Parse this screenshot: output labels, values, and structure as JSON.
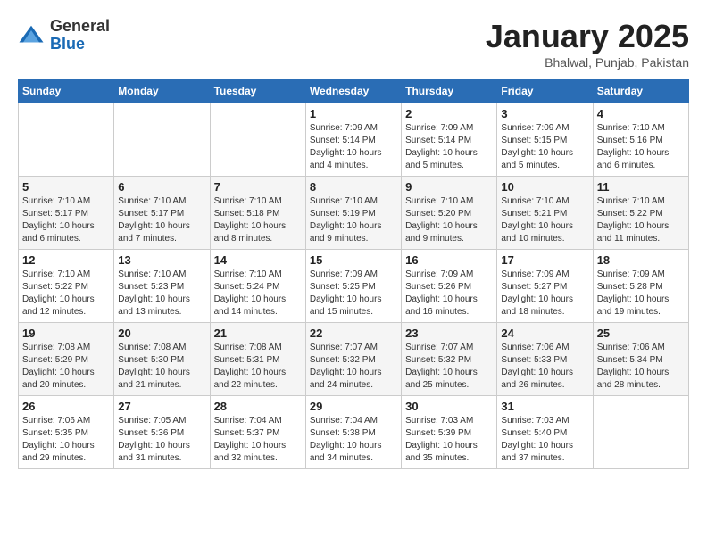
{
  "header": {
    "logo_general": "General",
    "logo_blue": "Blue",
    "month_title": "January 2025",
    "location": "Bhalwal, Punjab, Pakistan"
  },
  "weekdays": [
    "Sunday",
    "Monday",
    "Tuesday",
    "Wednesday",
    "Thursday",
    "Friday",
    "Saturday"
  ],
  "weeks": [
    [
      {
        "day": "",
        "info": ""
      },
      {
        "day": "",
        "info": ""
      },
      {
        "day": "",
        "info": ""
      },
      {
        "day": "1",
        "info": "Sunrise: 7:09 AM\nSunset: 5:14 PM\nDaylight: 10 hours\nand 4 minutes."
      },
      {
        "day": "2",
        "info": "Sunrise: 7:09 AM\nSunset: 5:14 PM\nDaylight: 10 hours\nand 5 minutes."
      },
      {
        "day": "3",
        "info": "Sunrise: 7:09 AM\nSunset: 5:15 PM\nDaylight: 10 hours\nand 5 minutes."
      },
      {
        "day": "4",
        "info": "Sunrise: 7:10 AM\nSunset: 5:16 PM\nDaylight: 10 hours\nand 6 minutes."
      }
    ],
    [
      {
        "day": "5",
        "info": "Sunrise: 7:10 AM\nSunset: 5:17 PM\nDaylight: 10 hours\nand 6 minutes."
      },
      {
        "day": "6",
        "info": "Sunrise: 7:10 AM\nSunset: 5:17 PM\nDaylight: 10 hours\nand 7 minutes."
      },
      {
        "day": "7",
        "info": "Sunrise: 7:10 AM\nSunset: 5:18 PM\nDaylight: 10 hours\nand 8 minutes."
      },
      {
        "day": "8",
        "info": "Sunrise: 7:10 AM\nSunset: 5:19 PM\nDaylight: 10 hours\nand 9 minutes."
      },
      {
        "day": "9",
        "info": "Sunrise: 7:10 AM\nSunset: 5:20 PM\nDaylight: 10 hours\nand 9 minutes."
      },
      {
        "day": "10",
        "info": "Sunrise: 7:10 AM\nSunset: 5:21 PM\nDaylight: 10 hours\nand 10 minutes."
      },
      {
        "day": "11",
        "info": "Sunrise: 7:10 AM\nSunset: 5:22 PM\nDaylight: 10 hours\nand 11 minutes."
      }
    ],
    [
      {
        "day": "12",
        "info": "Sunrise: 7:10 AM\nSunset: 5:22 PM\nDaylight: 10 hours\nand 12 minutes."
      },
      {
        "day": "13",
        "info": "Sunrise: 7:10 AM\nSunset: 5:23 PM\nDaylight: 10 hours\nand 13 minutes."
      },
      {
        "day": "14",
        "info": "Sunrise: 7:10 AM\nSunset: 5:24 PM\nDaylight: 10 hours\nand 14 minutes."
      },
      {
        "day": "15",
        "info": "Sunrise: 7:09 AM\nSunset: 5:25 PM\nDaylight: 10 hours\nand 15 minutes."
      },
      {
        "day": "16",
        "info": "Sunrise: 7:09 AM\nSunset: 5:26 PM\nDaylight: 10 hours\nand 16 minutes."
      },
      {
        "day": "17",
        "info": "Sunrise: 7:09 AM\nSunset: 5:27 PM\nDaylight: 10 hours\nand 18 minutes."
      },
      {
        "day": "18",
        "info": "Sunrise: 7:09 AM\nSunset: 5:28 PM\nDaylight: 10 hours\nand 19 minutes."
      }
    ],
    [
      {
        "day": "19",
        "info": "Sunrise: 7:08 AM\nSunset: 5:29 PM\nDaylight: 10 hours\nand 20 minutes."
      },
      {
        "day": "20",
        "info": "Sunrise: 7:08 AM\nSunset: 5:30 PM\nDaylight: 10 hours\nand 21 minutes."
      },
      {
        "day": "21",
        "info": "Sunrise: 7:08 AM\nSunset: 5:31 PM\nDaylight: 10 hours\nand 22 minutes."
      },
      {
        "day": "22",
        "info": "Sunrise: 7:07 AM\nSunset: 5:32 PM\nDaylight: 10 hours\nand 24 minutes."
      },
      {
        "day": "23",
        "info": "Sunrise: 7:07 AM\nSunset: 5:32 PM\nDaylight: 10 hours\nand 25 minutes."
      },
      {
        "day": "24",
        "info": "Sunrise: 7:06 AM\nSunset: 5:33 PM\nDaylight: 10 hours\nand 26 minutes."
      },
      {
        "day": "25",
        "info": "Sunrise: 7:06 AM\nSunset: 5:34 PM\nDaylight: 10 hours\nand 28 minutes."
      }
    ],
    [
      {
        "day": "26",
        "info": "Sunrise: 7:06 AM\nSunset: 5:35 PM\nDaylight: 10 hours\nand 29 minutes."
      },
      {
        "day": "27",
        "info": "Sunrise: 7:05 AM\nSunset: 5:36 PM\nDaylight: 10 hours\nand 31 minutes."
      },
      {
        "day": "28",
        "info": "Sunrise: 7:04 AM\nSunset: 5:37 PM\nDaylight: 10 hours\nand 32 minutes."
      },
      {
        "day": "29",
        "info": "Sunrise: 7:04 AM\nSunset: 5:38 PM\nDaylight: 10 hours\nand 34 minutes."
      },
      {
        "day": "30",
        "info": "Sunrise: 7:03 AM\nSunset: 5:39 PM\nDaylight: 10 hours\nand 35 minutes."
      },
      {
        "day": "31",
        "info": "Sunrise: 7:03 AM\nSunset: 5:40 PM\nDaylight: 10 hours\nand 37 minutes."
      },
      {
        "day": "",
        "info": ""
      }
    ]
  ]
}
